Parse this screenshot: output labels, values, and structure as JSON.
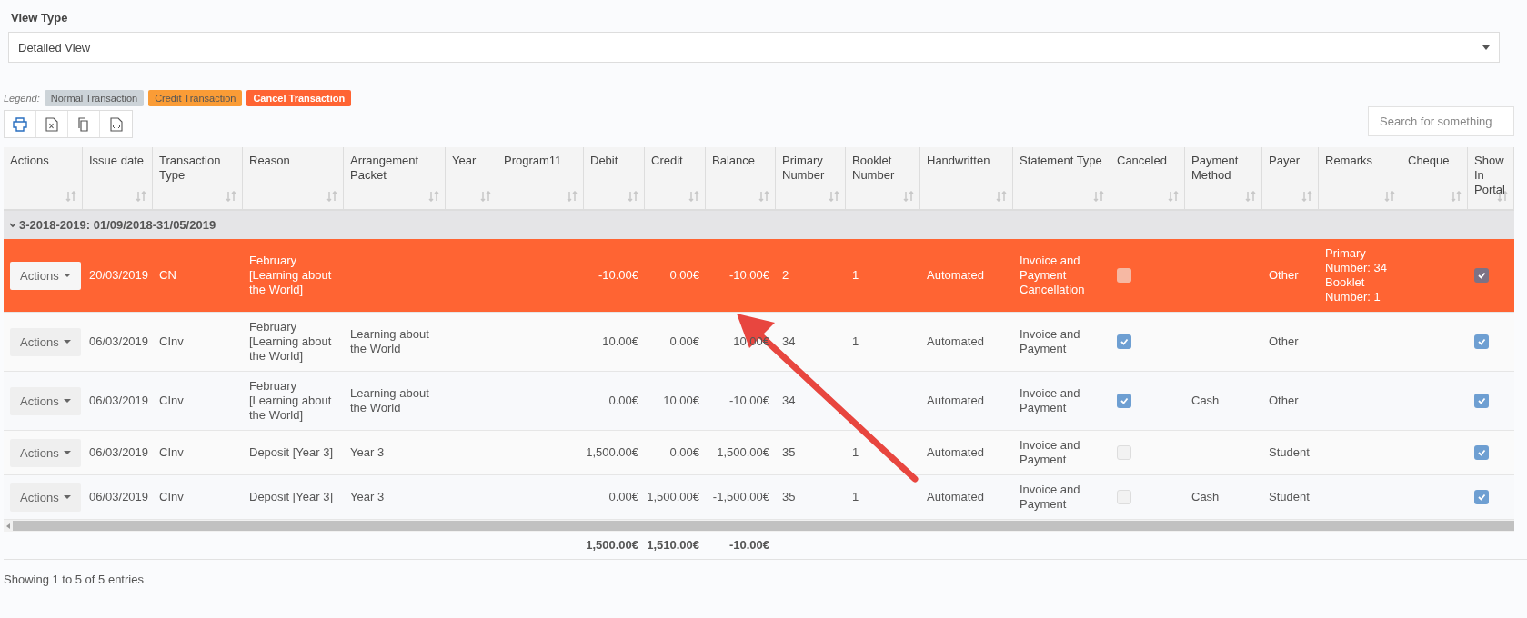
{
  "view_type": {
    "label": "View Type",
    "value": "Detailed View"
  },
  "legend": {
    "label": "Legend:",
    "items": [
      {
        "kind": "normal",
        "label": "Normal Transaction"
      },
      {
        "kind": "credit",
        "label": "Credit Transaction"
      },
      {
        "kind": "cancel",
        "label": "Cancel Transaction"
      }
    ]
  },
  "toolbar": [
    {
      "kind": "print"
    },
    {
      "kind": "excel"
    },
    {
      "kind": "copy"
    },
    {
      "kind": "code"
    }
  ],
  "search": {
    "placeholder": "Search for something"
  },
  "table": {
    "columns": [
      "Actions",
      "Issue date",
      "Transaction Type",
      "Reason",
      "Arrangement Packet",
      "Year",
      "Program11",
      "Debit",
      "Credit",
      "Balance",
      "Primary Number",
      "Booklet Number",
      "Handwritten",
      "Statement Type",
      "Canceled",
      "Payment Method",
      "Payer",
      "Remarks",
      "Cheque",
      "Show In Portal"
    ],
    "group": {
      "label": "3-2018-2019: 01/09/2018-31/05/2019",
      "expanded": true
    },
    "rows": [
      {
        "kind": "cancel",
        "actions": "Actions",
        "issue_date": "20/03/2019",
        "transaction_type": "CN",
        "reason": "February [Learning about the World]",
        "debit": "-10.00€",
        "credit": "0.00€",
        "balance": "-10.00€",
        "primary_number": "2",
        "booklet_number": "1",
        "handwritten": "Automated",
        "statement_type": "Invoice and Payment Cancellation",
        "canceled": false,
        "payer": "Other",
        "remarks": "Primary Number: 34 Booklet Number: 1",
        "show_in_portal": true
      },
      {
        "kind": "normal",
        "actions": "Actions",
        "issue_date": "06/03/2019",
        "transaction_type": "CInv",
        "reason": "February [Learning about the World]",
        "arrangement_packet": "Learning about the World",
        "debit": "10.00€",
        "credit": "0.00€",
        "balance": "10.00€",
        "primary_number": "34",
        "booklet_number": "1",
        "handwritten": "Automated",
        "statement_type": "Invoice and Payment",
        "canceled": true,
        "payer": "Other",
        "show_in_portal": true
      },
      {
        "kind": "normal",
        "actions": "Actions",
        "issue_date": "06/03/2019",
        "transaction_type": "CInv",
        "reason": "February [Learning about the World]",
        "arrangement_packet": "Learning about the World",
        "debit": "0.00€",
        "credit": "10.00€",
        "balance": "-10.00€",
        "primary_number": "34",
        "handwritten": "Automated",
        "statement_type": "Invoice and Payment",
        "canceled": true,
        "payment_method": "Cash",
        "payer": "Other",
        "show_in_portal": true
      },
      {
        "kind": "normal",
        "actions": "Actions",
        "issue_date": "06/03/2019",
        "transaction_type": "CInv",
        "reason": "Deposit [Year 3]",
        "arrangement_packet": "Year 3",
        "debit": "1,500.00€",
        "credit": "0.00€",
        "balance": "1,500.00€",
        "primary_number": "35",
        "booklet_number": "1",
        "handwritten": "Automated",
        "statement_type": "Invoice and Payment",
        "canceled": false,
        "payer": "Student",
        "show_in_portal": true
      },
      {
        "kind": "normal",
        "actions": "Actions",
        "issue_date": "06/03/2019",
        "transaction_type": "CInv",
        "reason": "Deposit [Year 3]",
        "arrangement_packet": "Year 3",
        "debit": "0.00€",
        "credit": "1,500.00€",
        "balance": "-1,500.00€",
        "primary_number": "35",
        "booklet_number": "1",
        "handwritten": "Automated",
        "statement_type": "Invoice and Payment",
        "canceled": false,
        "payment_method": "Cash",
        "payer": "Student",
        "show_in_portal": true
      }
    ],
    "totals": {
      "debit": "1,500.00€",
      "credit": "1,510.00€",
      "balance": "-10.00€"
    }
  },
  "status": "Showing 1 to 5 of 5 entries"
}
